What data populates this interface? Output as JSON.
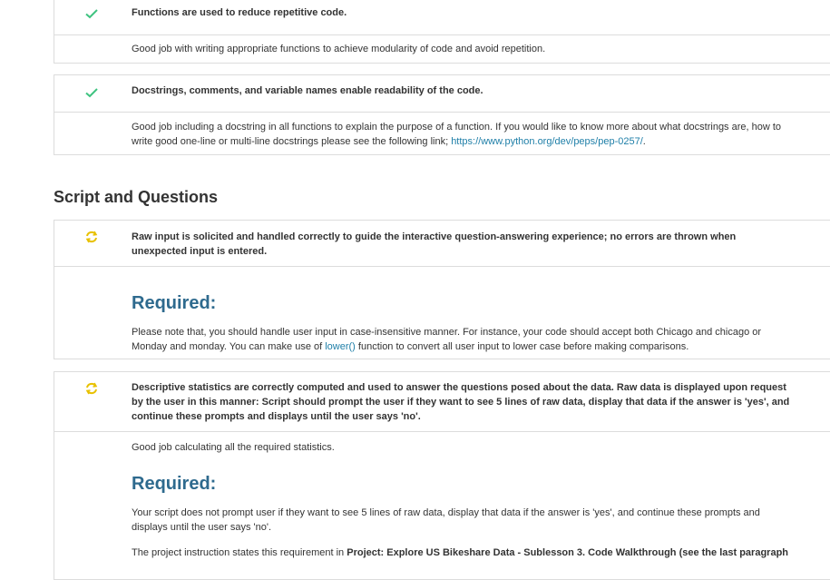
{
  "colors": {
    "pass": "#3fc380",
    "warn": "#e8c100",
    "required_heading": "#2e6a8e",
    "link": "#1f7fa8"
  },
  "functions_card": {
    "criterion": "Functions are used to reduce repetitive code.",
    "feedback": "Good job with writing appropriate functions to achieve modularity of code and avoid repetition.",
    "status_icon": "checkmark-icon"
  },
  "docstrings_card": {
    "criterion": "Docstrings, comments, and variable names enable readability of the code.",
    "feedback_line1": "Good job including a docstring in all functions to explain the purpose of a function. If you would like to know more about what docstrings are, how to",
    "feedback_line2_prefix": "write good one-line or multi-line docstrings please see the following link; ",
    "feedback_link": "https://www.python.org/dev/peps/pep-0257/",
    "feedback_suffix": ".",
    "status_icon": "checkmark-icon"
  },
  "section": {
    "title": "Script and Questions"
  },
  "raw_input_card": {
    "criterion_line1": "Raw input is solicited and handled correctly to guide the interactive question-answering experience; no errors are thrown when",
    "criterion_line2": "unexpected input is entered.",
    "required_heading": "Required:",
    "note_line1": "Please note that, you should handle user input in case-insensitive manner. For instance, your code should accept both Chicago and chicago or",
    "note_line2_prefix": "Monday and monday. You can make use of ",
    "note_link": "lower()",
    "note_line2_suffix": " function to convert all user input to lower case before making comparisons.",
    "status_icon": "refresh-icon"
  },
  "stats_card": {
    "criterion_line1": "Descriptive statistics are correctly computed and used to answer the questions posed about the data. Raw data is displayed upon request",
    "criterion_line2": "by the user in this manner: Script should prompt the user if they want to see 5 lines of raw data, display that data if the answer is 'yes', and",
    "criterion_line3": "continue these prompts and displays until the user says 'no'.",
    "feedback": "Good job calculating all the required statistics.",
    "required_heading": "Required:",
    "required_line1": "Your script does not prompt user if they want to see 5 lines of raw data, display that data if the answer is 'yes', and continue these prompts and",
    "required_line2": "displays until the user says 'no'.",
    "instruction_prefix": "The project instruction states this requirement in ",
    "instruction_bold": "Project: Explore US Bikeshare Data - Sublesson 3. Code Walkthrough (see the last paragraph",
    "status_icon": "refresh-icon"
  }
}
